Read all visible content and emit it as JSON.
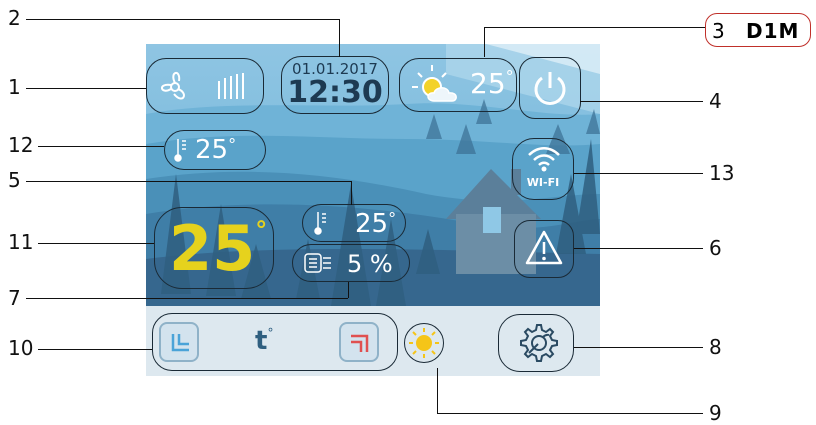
{
  "callouts": {
    "n1": "1",
    "n2": "2",
    "n3": "3",
    "n3_label": "D1M",
    "n4": "4",
    "n5": "5",
    "n6": "6",
    "n7": "7",
    "n8": "8",
    "n9": "9",
    "n10": "10",
    "n11": "11",
    "n12": "12",
    "n13": "13"
  },
  "datetime": {
    "date": "01.01.2017",
    "time": "12:30"
  },
  "weather": {
    "icon": "sun-cloud-icon",
    "temp": "25",
    "deg": "°"
  },
  "outside_temp": {
    "value": "25",
    "deg": "°"
  },
  "setpoint": {
    "value": "25",
    "deg": "°"
  },
  "room_temp": {
    "value": "25",
    "deg": "°"
  },
  "humidity": {
    "value": "5 %"
  },
  "wifi": {
    "label": "WI-FI"
  },
  "controls": {
    "t_label": "t",
    "t_deg": "°"
  },
  "colors": {
    "setpoint": "#e6d21d",
    "accent_red": "#e05050",
    "btn_blue": "#4aa3d8"
  }
}
